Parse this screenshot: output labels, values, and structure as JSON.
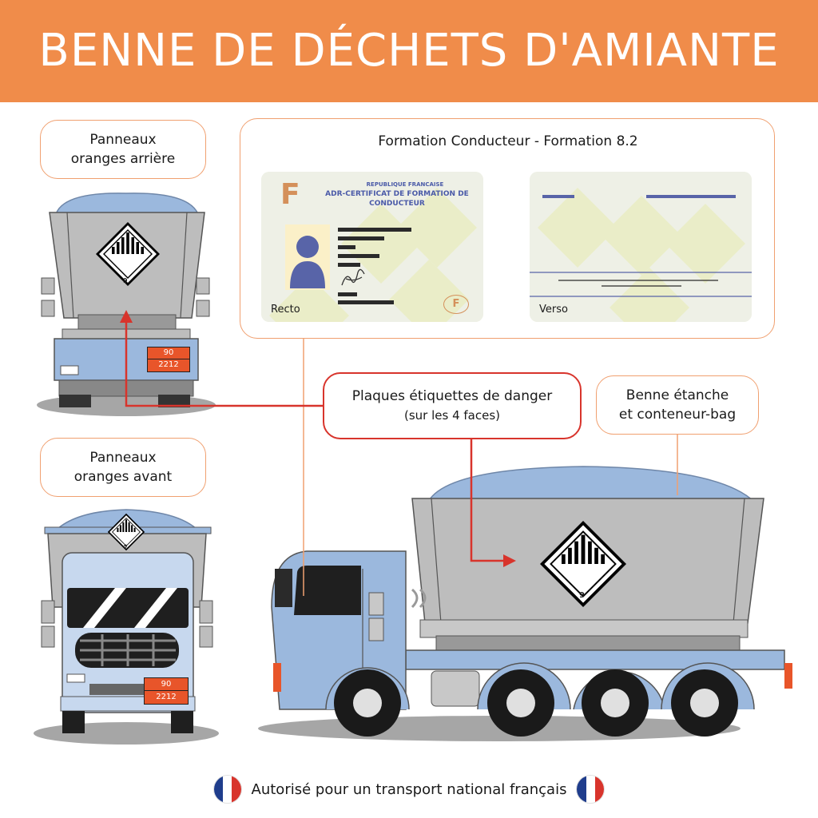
{
  "header": {
    "title": "BENNE DE DÉCHETS D'AMIANTE"
  },
  "labels": {
    "rear": [
      "Panneaux",
      "oranges arrière"
    ],
    "front": [
      "Panneaux",
      "oranges avant"
    ],
    "danger": {
      "main": "Plaques étiquettes de danger",
      "sub": "(sur les 4 faces)"
    },
    "benne": [
      "Benne étanche",
      "et conteneur-bag"
    ]
  },
  "formation": {
    "title": "Formation Conducteur - Formation 8.2",
    "recto": {
      "letter": "F",
      "republic": "REPUBLIQUE FRANCAISE",
      "certificate": "ADR-CERTIFICAT DE FORMATION DE CONDUCTEUR",
      "side": "Recto",
      "emblem": "F"
    },
    "verso": {
      "side": "Verso"
    }
  },
  "plates": {
    "rear": {
      "top": "90",
      "bottom": "2212"
    },
    "front": {
      "top": "90",
      "bottom": "2212"
    }
  },
  "hazard_label": {
    "class_number": "9"
  },
  "colors": {
    "header": "#f08c4a",
    "accent_red": "#d8342c",
    "plate_orange": "#e8552a",
    "truck_blue": "#9bb8dd",
    "bin_gray": "#bdbdbd"
  },
  "footer": {
    "text": "Autorisé pour un transport national français",
    "flag_icon": "french-flag-icon"
  }
}
